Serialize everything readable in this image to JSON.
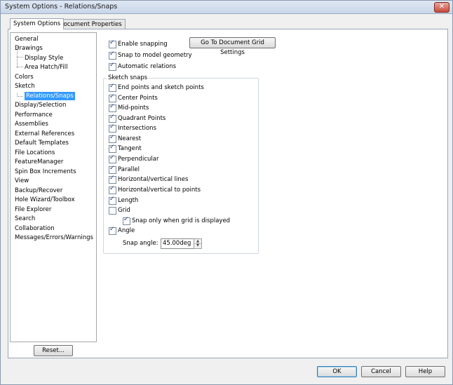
{
  "window": {
    "title": "System Options - Relations/Snaps",
    "close_glyph": "✕"
  },
  "tabs": [
    {
      "label": "System Options",
      "active": true
    },
    {
      "label": "Document Properties",
      "active": false
    }
  ],
  "tree": [
    {
      "label": "General"
    },
    {
      "label": "Drawings"
    },
    {
      "label": "Display Style"
    },
    {
      "label": "Area Hatch/Fill"
    },
    {
      "label": "Colors"
    },
    {
      "label": "Sketch"
    },
    {
      "label": "Relations/Snaps",
      "selected": true
    },
    {
      "label": "Display/Selection"
    },
    {
      "label": "Performance"
    },
    {
      "label": "Assemblies"
    },
    {
      "label": "External References"
    },
    {
      "label": "Default Templates"
    },
    {
      "label": "File Locations"
    },
    {
      "label": "FeatureManager"
    },
    {
      "label": "Spin Box Increments"
    },
    {
      "label": "View"
    },
    {
      "label": "Backup/Recover"
    },
    {
      "label": "Hole Wizard/Toolbox"
    },
    {
      "label": "File Explorer"
    },
    {
      "label": "Search"
    },
    {
      "label": "Collaboration"
    },
    {
      "label": "Messages/Errors/Warnings"
    }
  ],
  "top_options": [
    {
      "label": "Enable snapping",
      "checked": true
    },
    {
      "label": "Snap to model geometry",
      "checked": true
    },
    {
      "label": "Automatic relations",
      "checked": true
    }
  ],
  "grid_button": "Go To Document Grid Settings",
  "sketch_snaps": {
    "title": "Sketch snaps",
    "items": [
      {
        "label": "End points and sketch points",
        "checked": true
      },
      {
        "label": "Center Points",
        "checked": true
      },
      {
        "label": "Mid-points",
        "checked": true
      },
      {
        "label": "Quadrant Points",
        "checked": true
      },
      {
        "label": "Intersections",
        "checked": true
      },
      {
        "label": "Nearest",
        "checked": true
      },
      {
        "label": "Tangent",
        "checked": true
      },
      {
        "label": "Perpendicular",
        "checked": true
      },
      {
        "label": "Parallel",
        "checked": true
      },
      {
        "label": "Horizontal/vertical lines",
        "checked": true
      },
      {
        "label": "Horizontal/vertical to points",
        "checked": true
      },
      {
        "label": "Length",
        "checked": true
      },
      {
        "label": "Grid",
        "checked": false
      },
      {
        "label": "Snap only when grid is displayed",
        "checked": true
      },
      {
        "label": "Angle",
        "checked": true
      }
    ],
    "snap_angle_label": "Snap angle:",
    "snap_angle_value": "45.00deg"
  },
  "buttons": {
    "reset": "Reset...",
    "ok": "OK",
    "cancel": "Cancel",
    "help": "Help"
  },
  "icons": {
    "spin_up": "▲",
    "spin_down": "▼"
  }
}
